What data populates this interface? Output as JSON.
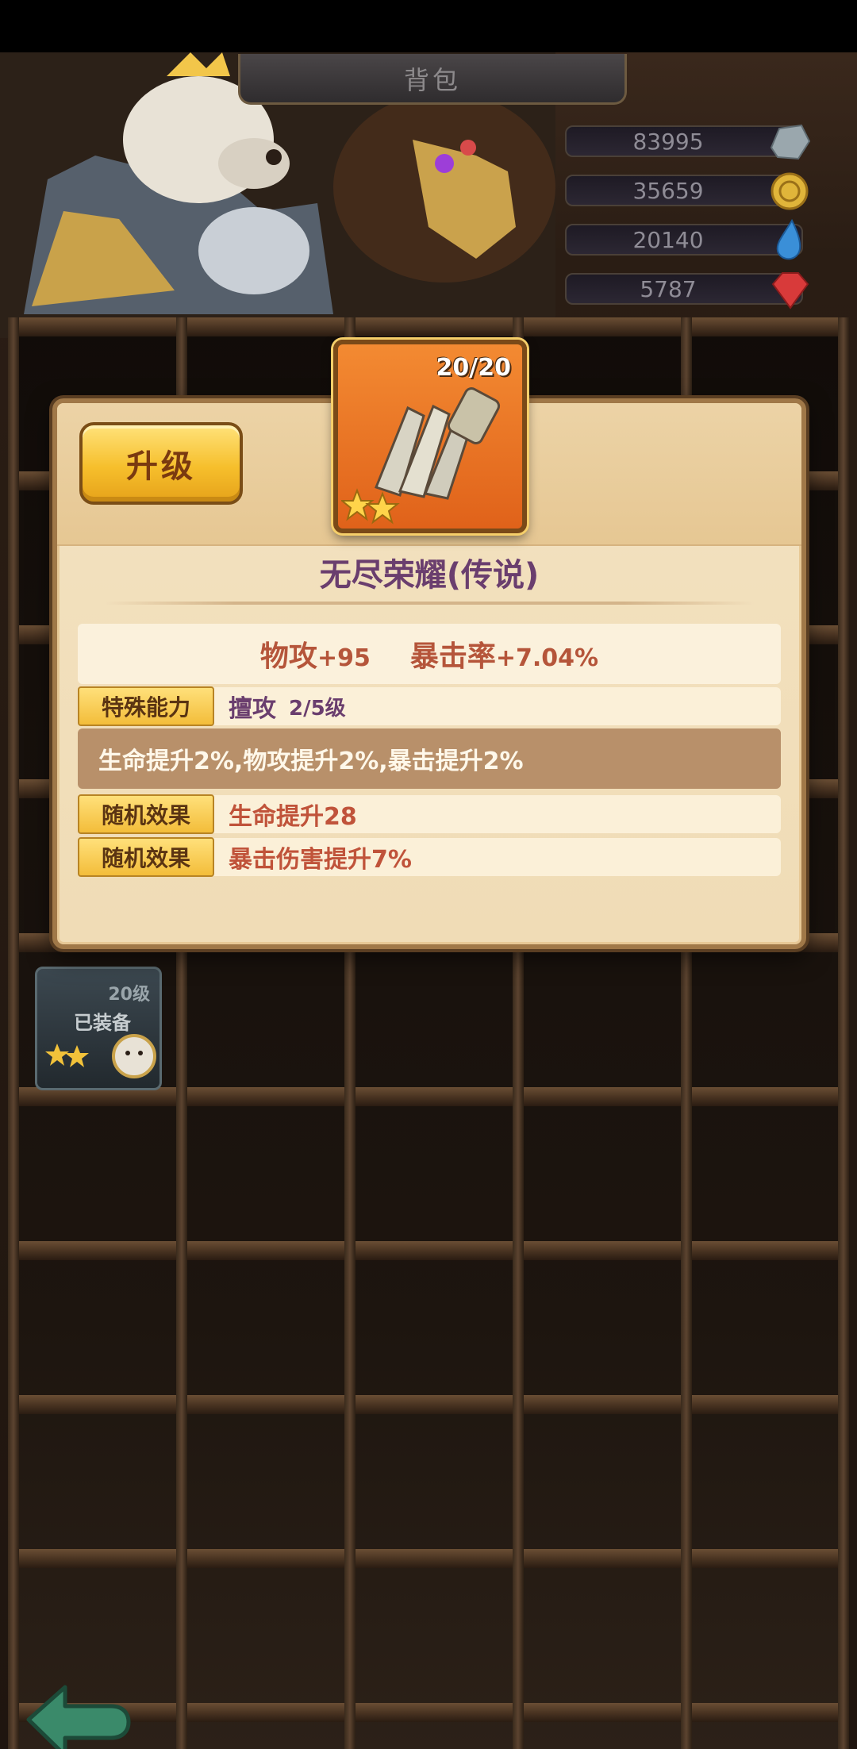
{
  "header": {
    "title": "背包"
  },
  "currencies": [
    {
      "value": "83995",
      "icon": "stone-icon",
      "color": "#9aa7ad"
    },
    {
      "value": "35659",
      "icon": "gold-coin-icon",
      "color": "#e0b53a"
    },
    {
      "value": "20140",
      "icon": "water-drop-icon",
      "color": "#3a8fd8"
    },
    {
      "value": "5787",
      "icon": "red-gem-icon",
      "color": "#d83a3a"
    }
  ],
  "detail": {
    "upgrade_label": "升级",
    "item_count": "20/20",
    "stars": 2,
    "item_name": "无尽荣耀(传说)",
    "stats": [
      {
        "name": "物攻",
        "value": "+95"
      },
      {
        "name": "暴击率",
        "value": "+7.04%"
      }
    ],
    "special": {
      "label": "特殊能力",
      "name": "擅攻",
      "level": "2/5级"
    },
    "special_desc": "生命提升2%,物攻提升2%,暴击提升2%",
    "random_effects": [
      {
        "label": "随机效果",
        "value": "生命提升28"
      },
      {
        "label": "随机效果",
        "value": "暴击伤害提升7%"
      }
    ]
  },
  "equipped_slot": {
    "level": "20级",
    "tag": "已装备",
    "stars": 2
  },
  "colors": {
    "panel_bg": "#f2e0bd",
    "upgrade_button": "#f6bf2c",
    "item_bg": "#e0621a",
    "shelf_wood": "#4a3422"
  }
}
